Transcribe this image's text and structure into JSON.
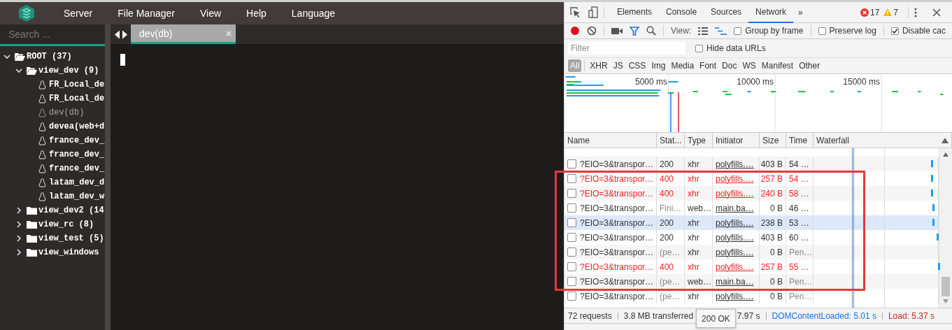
{
  "app": {
    "menu": [
      "Server",
      "File Manager",
      "View",
      "Help",
      "Language"
    ],
    "search": {
      "placeholder": "Search ..."
    },
    "tree": [
      {
        "label": "ROOT (37)",
        "kind": "folder",
        "expanded": true,
        "selected": false,
        "children": [
          {
            "label": "view_dev (9)",
            "kind": "folder",
            "expanded": true,
            "selected": false,
            "children": [
              {
                "label": "FR_Local_de",
                "kind": "server",
                "selected": false
              },
              {
                "label": "FR_Local_de",
                "kind": "server",
                "selected": false
              },
              {
                "label": "dev(db)",
                "kind": "server",
                "selected": true
              },
              {
                "label": "devea(web+d",
                "kind": "server",
                "selected": false
              },
              {
                "label": "france_dev_",
                "kind": "server",
                "selected": false
              },
              {
                "label": "france_dev_",
                "kind": "server",
                "selected": false
              },
              {
                "label": "france_dev_",
                "kind": "server",
                "selected": false
              },
              {
                "label": "latam_dev_d",
                "kind": "server",
                "selected": false
              },
              {
                "label": "latam_dev_w",
                "kind": "server",
                "selected": false
              }
            ]
          },
          {
            "label": "view_dev2 (14",
            "kind": "folder",
            "expanded": false,
            "selected": false
          },
          {
            "label": "view_rc (8)",
            "kind": "folder",
            "expanded": false,
            "selected": false
          },
          {
            "label": "view_test (5)",
            "kind": "folder",
            "expanded": false,
            "selected": false
          },
          {
            "label": "view_windows",
            "kind": "folder",
            "expanded": false,
            "selected": false
          }
        ]
      }
    ],
    "editor_tab": {
      "label": "dev(db)",
      "selected": true
    }
  },
  "devtools": {
    "tabs": [
      {
        "label": "Elements",
        "selected": false
      },
      {
        "label": "Console",
        "selected": false
      },
      {
        "label": "Sources",
        "selected": false
      },
      {
        "label": "Network",
        "selected": true
      }
    ],
    "more": "»",
    "errors": "17",
    "warnings": "7",
    "view_label": "View:",
    "options": [
      {
        "label": "Group by frame",
        "checked": false
      },
      {
        "label": "Preserve log",
        "checked": false
      },
      {
        "label": "Disable cac",
        "checked": true
      }
    ],
    "filter": {
      "placeholder": "Filter"
    },
    "hide_data_urls": {
      "label": "Hide data URLs",
      "checked": false
    },
    "type_filters": [
      {
        "label": "All",
        "selected": true
      },
      {
        "label": "XHR",
        "selected": false
      },
      {
        "label": "JS",
        "selected": false
      },
      {
        "label": "CSS",
        "selected": false
      },
      {
        "label": "Img",
        "selected": false
      },
      {
        "label": "Media",
        "selected": false
      },
      {
        "label": "Font",
        "selected": false
      },
      {
        "label": "Doc",
        "selected": false
      },
      {
        "label": "WS",
        "selected": false
      },
      {
        "label": "Manifest",
        "selected": false
      },
      {
        "label": "Other",
        "selected": false
      }
    ],
    "overview_ticks": [
      "5000 ms",
      "10000 ms",
      "15000 ms"
    ],
    "columns": [
      "Name",
      "Stat...",
      "Type",
      "Initiator",
      "Size",
      "Time",
      "Waterfall"
    ],
    "rows": [
      {
        "name": "?EIO=3&transpor…",
        "status": "200",
        "type": "xhr",
        "initiator": "polyfills.…",
        "size": "403 B",
        "time": "54 …",
        "kind": "ok",
        "selected": false
      },
      {
        "name": "?EIO=3&transpor…",
        "status": "400",
        "type": "xhr",
        "initiator": "polyfills.…",
        "size": "257 B",
        "time": "54 …",
        "kind": "error",
        "selected": false
      },
      {
        "name": "?EIO=3&transpor…",
        "status": "400",
        "type": "xhr",
        "initiator": "polyfills.…",
        "size": "240 B",
        "time": "58 …",
        "kind": "error",
        "selected": false
      },
      {
        "name": "?EIO=3&transpor…",
        "status": "Fini…",
        "type": "web…",
        "initiator": "main.ba…",
        "size": "0 B",
        "time": "46 …",
        "kind": "finished",
        "selected": false
      },
      {
        "name": "?EIO=3&transpor…",
        "status": "200",
        "type": "xhr",
        "initiator": "polyfills.…",
        "size": "238 B",
        "time": "53 …",
        "kind": "ok",
        "selected": true
      },
      {
        "name": "?EIO=3&transpor…",
        "status": "200",
        "type": "xhr",
        "initiator": "polyfills.…",
        "size": "403 B",
        "time": "60 …",
        "kind": "ok",
        "selected": false
      },
      {
        "name": "?EIO=3&transpor…",
        "status": "(pe…",
        "type": "xhr",
        "initiator": "polyfills.…",
        "size": "0 B",
        "time": "Pen…",
        "kind": "pending",
        "selected": false
      },
      {
        "name": "?EIO=3&transpor…",
        "status": "400",
        "type": "xhr",
        "initiator": "polyfills.…",
        "size": "257 B",
        "time": "55 …",
        "kind": "error",
        "selected": false
      },
      {
        "name": "?EIO=3&transpor…",
        "status": "(pe…",
        "type": "web…",
        "initiator": "main.ba…",
        "size": "0 B",
        "time": "Pen…",
        "kind": "pending",
        "selected": false
      },
      {
        "name": "?EIO=3&transpor…",
        "status": "(pe…",
        "type": "xhr",
        "initiator": "polyfills.…",
        "size": "0 B",
        "time": "Pen…",
        "kind": "pending",
        "selected": false
      }
    ],
    "status": {
      "requests": "72 requests",
      "transferred": "3.8 MB transferred",
      "finish": "7.97 s",
      "dom": "DOMContentLoaded: 5.01 s",
      "load": "Load: 5.37 s"
    },
    "tooltip": "200 OK"
  }
}
